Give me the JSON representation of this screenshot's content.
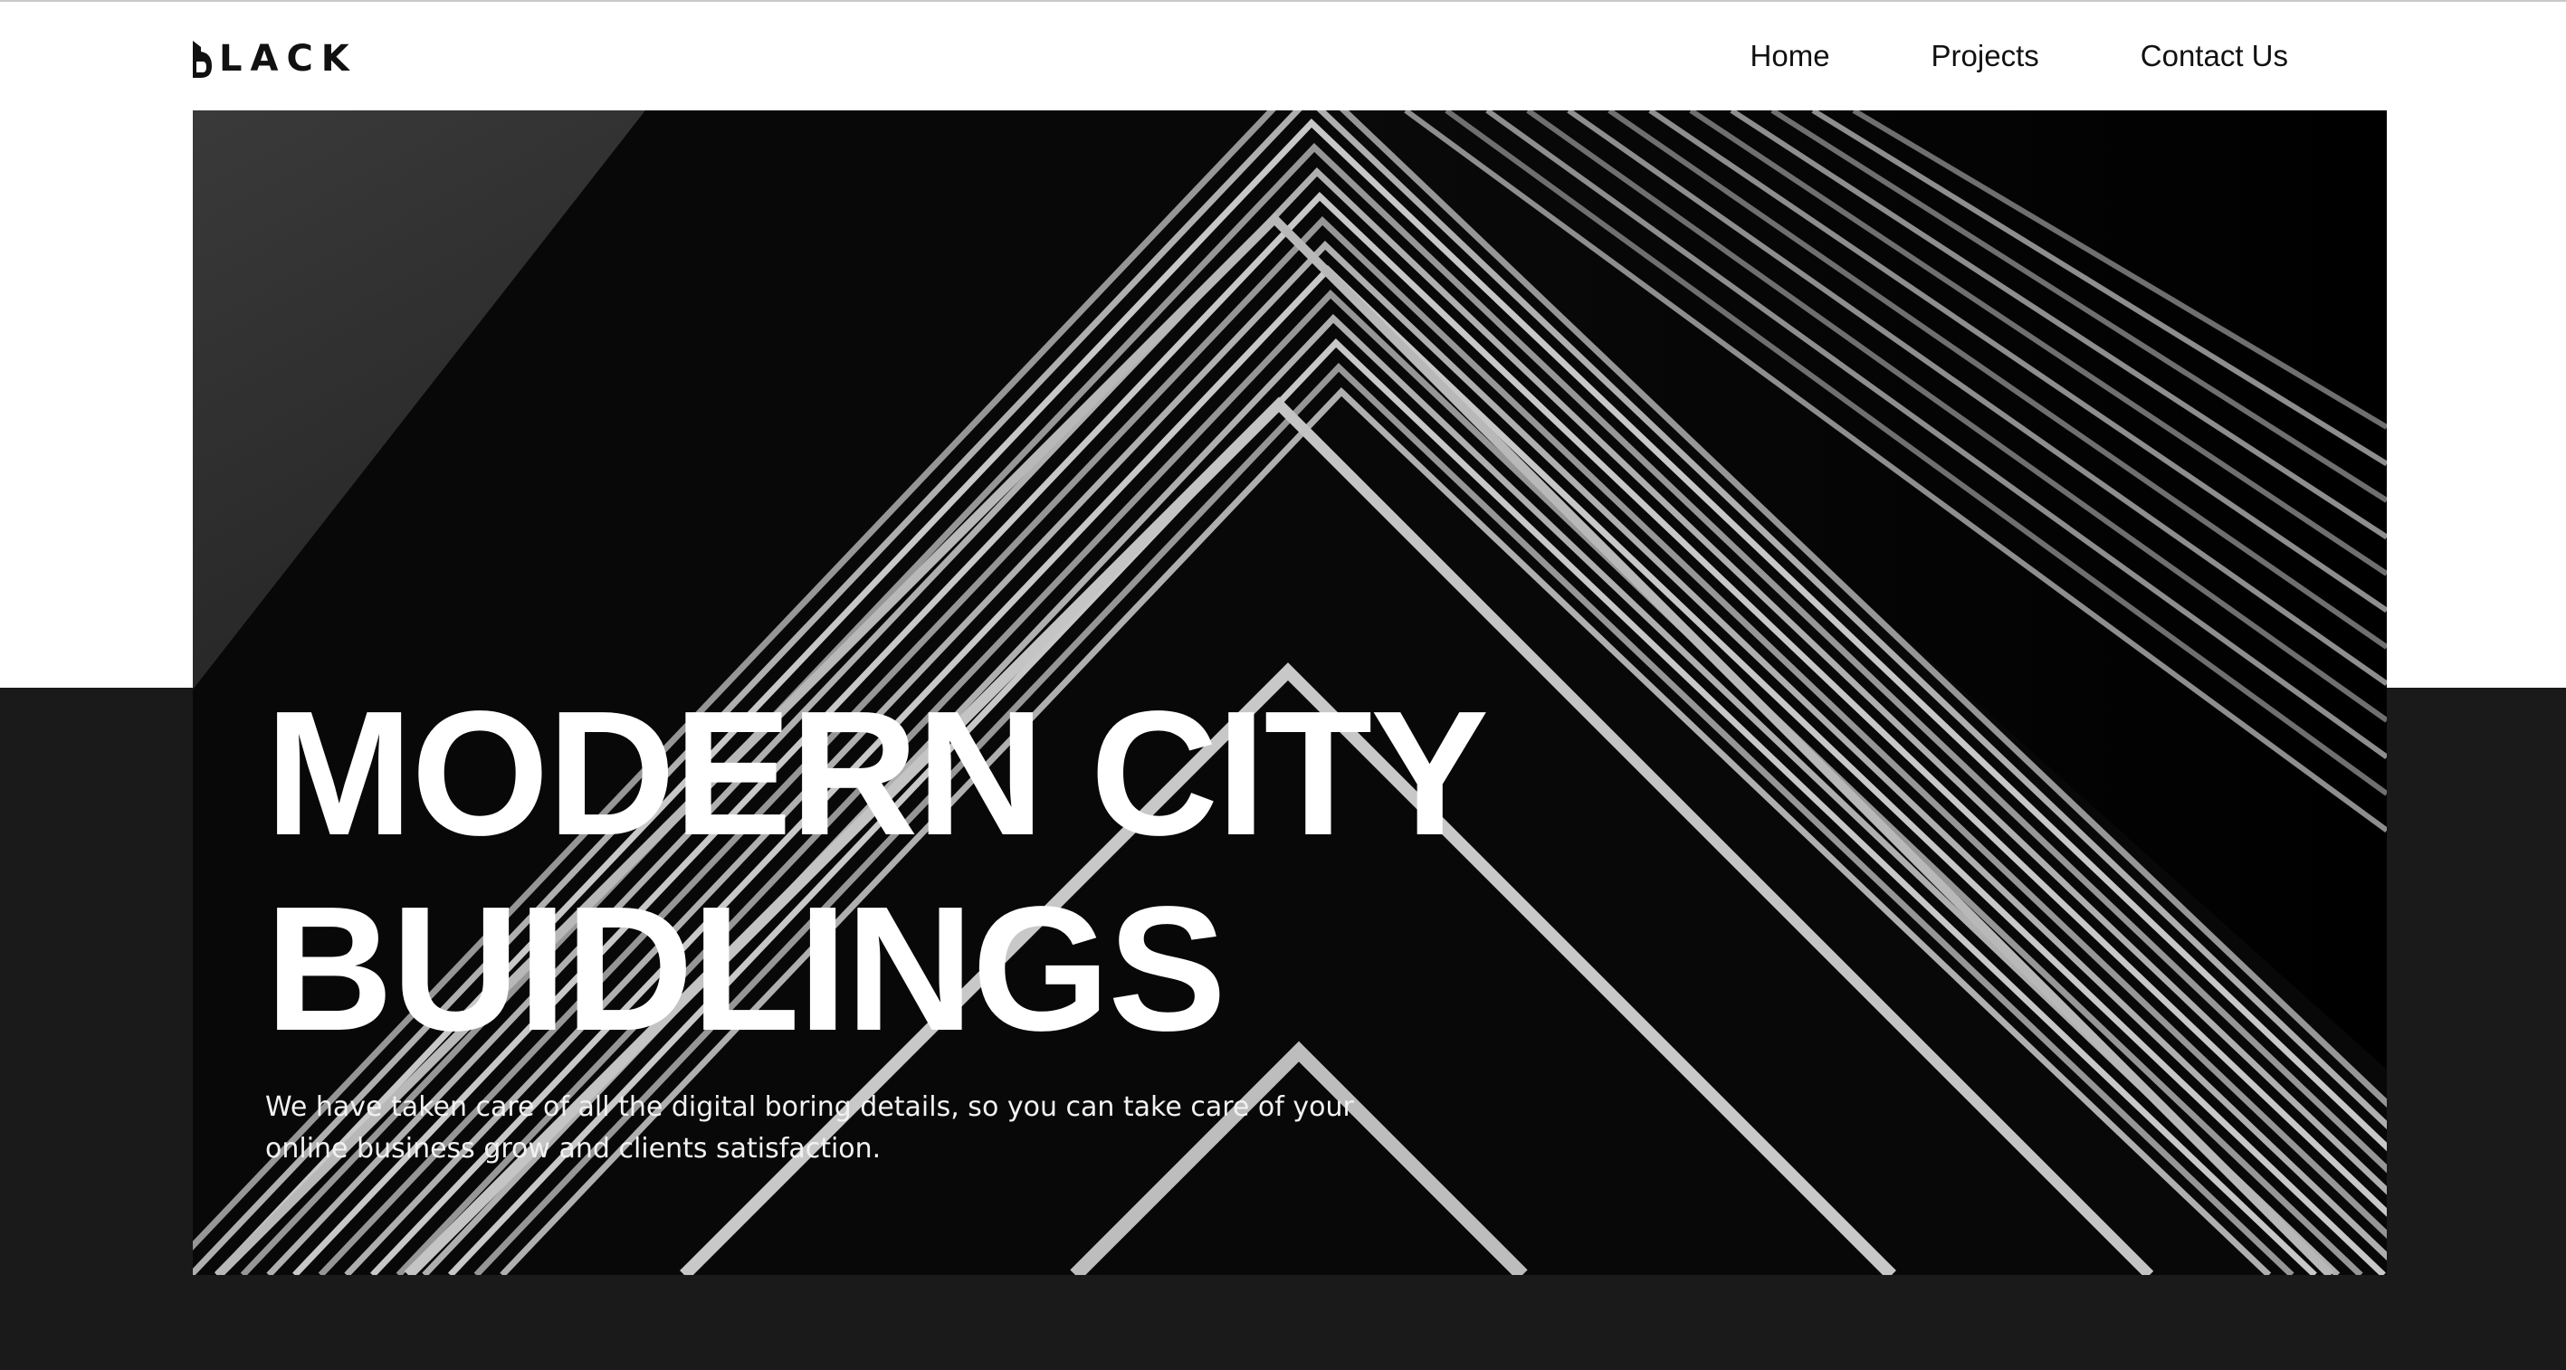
{
  "brand": {
    "logo_text": "LACK",
    "logo_mark": "B"
  },
  "nav": {
    "items": [
      {
        "label": "Home"
      },
      {
        "label": "Projects"
      },
      {
        "label": "Contact Us"
      }
    ]
  },
  "hero": {
    "title_line_1": "MODERN CITY",
    "title_line_2": "BUIDLINGS",
    "description": "We have taken care of all the digital boring details, so you can take care of your online business grow and clients satisfaction.",
    "image_icon": "building-photo"
  },
  "colors": {
    "page_background": "#ffffff",
    "dark_band": "#1a1a1a",
    "text_dark": "#111111",
    "text_light": "#ffffff"
  }
}
